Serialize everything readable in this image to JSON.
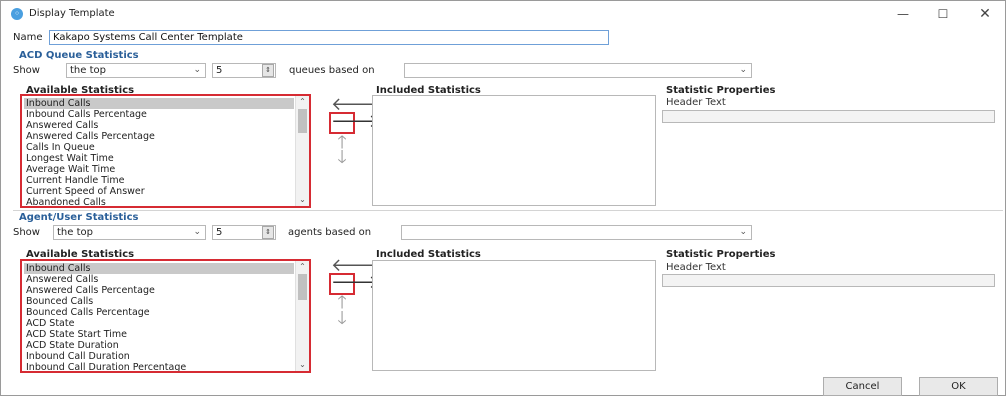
{
  "window": {
    "title": "Display Template",
    "controls": {
      "minimize": "—",
      "maximize": "☐",
      "close": "✕"
    }
  },
  "name": {
    "label": "Name",
    "value": "Kakapo Systems Call Center Template"
  },
  "acd": {
    "section_title": "ACD Queue Statistics",
    "show_label": "Show",
    "show_value": "the top",
    "count_value": "5",
    "based_on_label": "queues based on",
    "based_on_value": "",
    "available_title": "Available Statistics",
    "available_items": [
      "Inbound Calls",
      "Inbound Calls Percentage",
      "Answered Calls",
      "Answered Calls Percentage",
      "Calls In Queue",
      "Longest Wait Time",
      "Average Wait Time",
      "Current Handle Time",
      "Current Speed of Answer",
      "Abandoned Calls"
    ],
    "selected_index": 0,
    "included_title": "Included Statistics",
    "included_items": [],
    "properties_title": "Statistic Properties",
    "header_text_label": "Header Text",
    "header_text_value": ""
  },
  "agent": {
    "section_title": "Agent/User Statistics",
    "show_label": "Show",
    "show_value": "the top",
    "count_value": "5",
    "based_on_label": "agents based on",
    "based_on_value": "",
    "available_title": "Available Statistics",
    "available_items": [
      "Inbound Calls",
      "Answered Calls",
      "Answered Calls Percentage",
      "Bounced Calls",
      "Bounced Calls Percentage",
      "ACD State",
      "ACD State Start Time",
      "ACD State Duration",
      "Inbound Call Duration",
      "Inbound Call Duration Percentage"
    ],
    "selected_index": 0,
    "included_title": "Included Statistics",
    "included_items": [],
    "properties_title": "Statistic Properties",
    "header_text_label": "Header Text",
    "header_text_value": ""
  },
  "icons": {
    "move_left": "arrow-left-icon",
    "move_right": "arrow-right-icon",
    "move_up": "arrow-up-icon",
    "move_down": "arrow-down-icon"
  },
  "colors": {
    "section_title": "#2a5f99",
    "highlight_border": "#d62b33",
    "selection": "#c9c9c9"
  },
  "footer": {
    "cancel_label": "Cancel",
    "ok_label": "OK"
  }
}
